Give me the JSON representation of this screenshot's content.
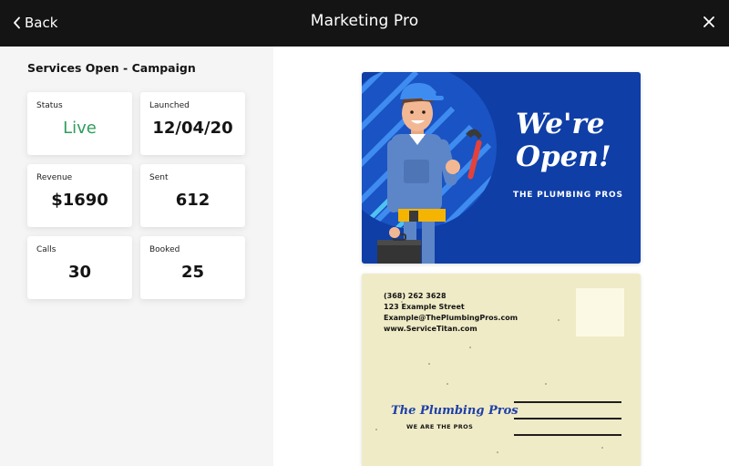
{
  "header": {
    "back_label": "Back",
    "title": "Marketing Pro"
  },
  "sidebar": {
    "campaign_title": "Services Open - Campaign",
    "stats": [
      {
        "label": "Status",
        "value": "Live"
      },
      {
        "label": "Launched",
        "value": "12/04/20"
      },
      {
        "label": "Revenue",
        "value": "$1690"
      },
      {
        "label": "Sent",
        "value": "612"
      },
      {
        "label": "Calls",
        "value": "30"
      },
      {
        "label": "Booked",
        "value": "25"
      }
    ]
  },
  "postcard": {
    "front": {
      "headline": "We're Open!",
      "brand": "THE PLUMBING PROS"
    },
    "back": {
      "phone": "(368) 262 3628",
      "street": "123 Example Street",
      "email": "Example@ThePlumbingPros.com",
      "website": "www.ServiceTitan.com",
      "logo_text": "The Plumbing Pros",
      "tagline": "WE ARE THE PROS"
    }
  },
  "colors": {
    "topbar": "#141414",
    "status_live": "#2f9d5c",
    "postcard_blue": "#0f3ea6",
    "postcard_cream": "#efebc6"
  },
  "icons": {
    "back": "chevron-left-icon",
    "close": "close-icon"
  }
}
